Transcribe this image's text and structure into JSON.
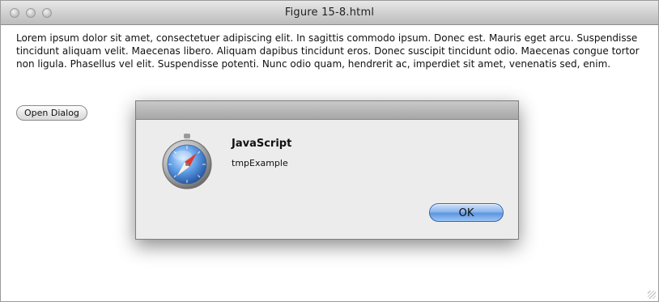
{
  "window": {
    "title": "Figure 15-8.html"
  },
  "page": {
    "paragraph": "Lorem ipsum dolor sit amet, consectetuer adipiscing elit. In sagittis commodo ipsum. Donec est. Mauris eget arcu. Suspendisse tincidunt aliquam velit. Maecenas libero. Aliquam dapibus tincidunt eros. Donec suscipit tincidunt odio. Maecenas congue tortor non ligula. Phasellus vel elit. Suspendisse potenti. Nunc odio quam, hendrerit ac, imperdiet sit amet, venenatis sed, enim.",
    "open_dialog_label": "Open Dialog"
  },
  "dialog": {
    "title": "JavaScript",
    "message": "tmpExample",
    "ok_label": "OK",
    "icon": "safari-compass-icon"
  },
  "colors": {
    "ok_accent": "#6fa3e6",
    "titlebar": "#cfcfcf"
  }
}
